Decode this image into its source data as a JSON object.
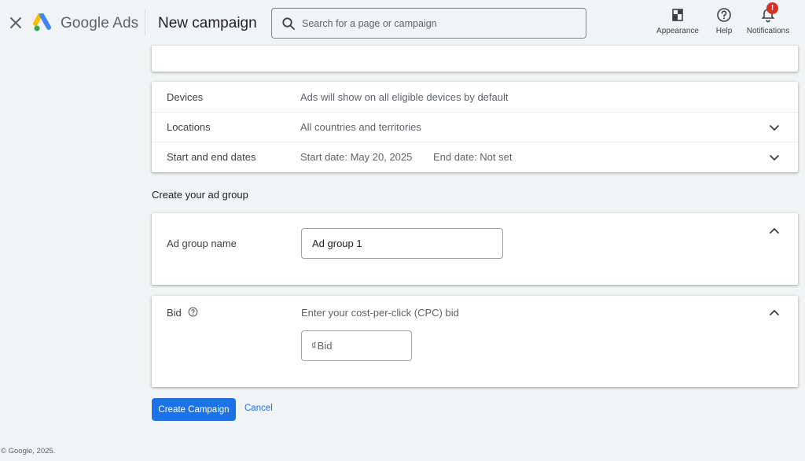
{
  "header": {
    "brand": "Google Ads",
    "page_title": "New campaign",
    "search_placeholder": "Search for a page or campaign",
    "tools": {
      "appearance": "Appearance",
      "help": "Help",
      "notifications": "Notifications",
      "notifications_badge": "!"
    },
    "icons": {
      "close": "close-icon",
      "logo": "google-ads-logo",
      "search": "search-icon",
      "appearance": "appearance-icon",
      "help": "help-circle-icon",
      "notifications": "bell-icon"
    }
  },
  "campaign_settings": {
    "rows": [
      {
        "label": "Devices",
        "value": "Ads will show on all eligible devices by default"
      },
      {
        "label": "Locations",
        "value": "All countries and territories"
      },
      {
        "label": "Start and end dates",
        "value": "Start date: May 20, 2025",
        "value2": "End date: Not set"
      }
    ]
  },
  "ad_group": {
    "heading": "Create your ad group",
    "name_label": "Ad group name",
    "name_value": "Ad group 1",
    "bid_label": "Bid",
    "bid_description": "Enter your cost-per-click (CPC) bid",
    "bid_currency": "₫",
    "bid_placeholder": "Bid"
  },
  "actions": {
    "create": "Create Campaign",
    "cancel": "Cancel"
  },
  "footer": "© Google, 2025.",
  "colors": {
    "accent": "#1a73e8",
    "background": "#f1f3f4",
    "badge": "#d93025"
  }
}
